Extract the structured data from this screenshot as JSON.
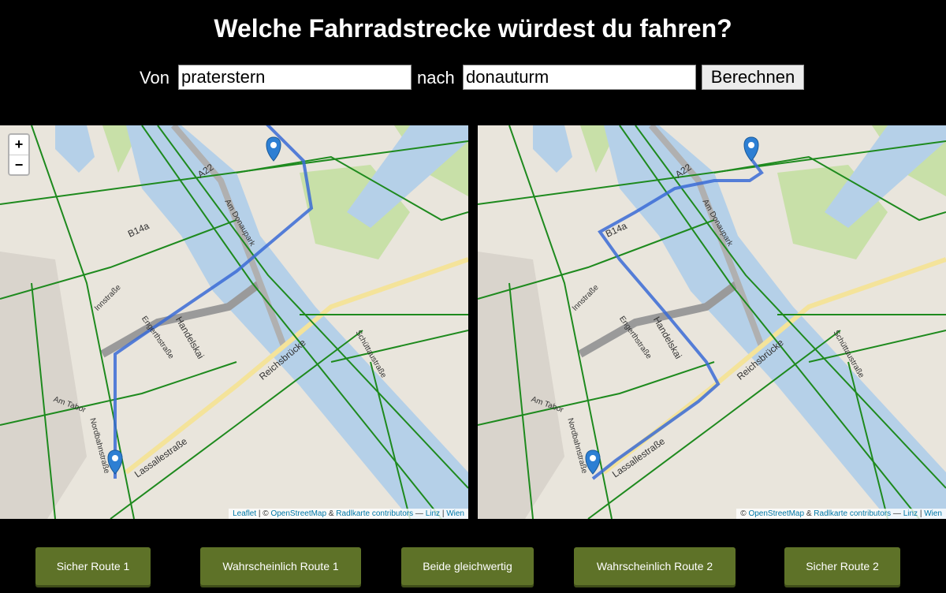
{
  "header": {
    "title": "Welche Fahrradstrecke würdest du fahren?"
  },
  "form": {
    "from_label": "Von",
    "from_value": "praterstern",
    "to_label": "nach",
    "to_value": "donauturm",
    "submit_label": "Berechnen"
  },
  "map": {
    "zoom_in": "+",
    "zoom_out": "−",
    "labels": {
      "a22": "A22",
      "b14a": "B14a",
      "am_donaupark": "Am Donaupark",
      "innstrasse": "Innstraße",
      "engerthstrasse": "Engerthstraße",
      "handelskai": "Handelskai",
      "reichsbruecke": "Reichsbrücke",
      "schuettaustrasse": "Schüttaustraße",
      "am_tabor": "Am Tabor",
      "nordbahnstrasse": "Nordbahnstraße",
      "lassallestrasse": "Lassallestraße"
    },
    "attribution": {
      "leaflet": "Leaflet",
      "sep1": " | © ",
      "osm": "OpenStreetMap",
      "amp": " & ",
      "radlkarte": "Radlkarte contributors",
      "dash": " — ",
      "linz": "Linz",
      "pipe": " | ",
      "wien": "Wien",
      "copy": "© "
    },
    "colors": {
      "route": "#3a6bd6",
      "bikepath": "#1e8a1e",
      "water": "#b5d0e8",
      "park": "#c8e0a8",
      "land": "#e9e5dc"
    }
  },
  "votes": {
    "safe1": "Sicher Route 1",
    "likely1": "Wahrscheinlich Route 1",
    "equal": "Beide gleichwertig",
    "likely2": "Wahrscheinlich Route 2",
    "safe2": "Sicher Route 2"
  }
}
